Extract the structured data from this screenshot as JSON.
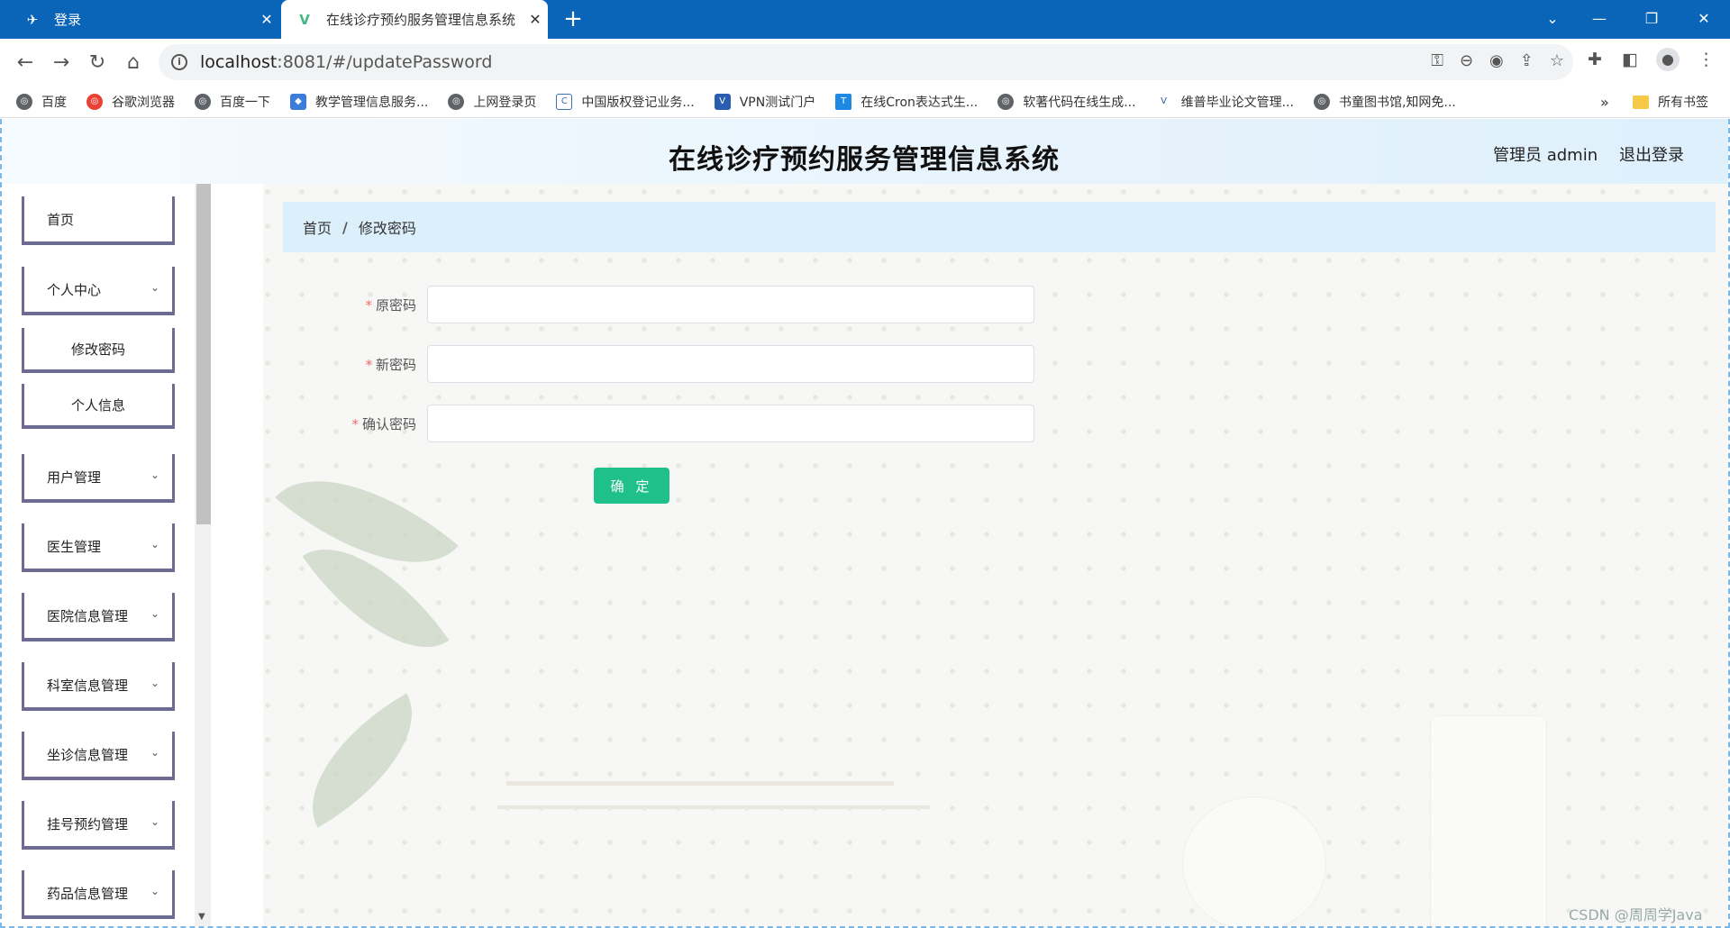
{
  "browser": {
    "tabs": [
      {
        "title": "登录",
        "icon": "page-icon"
      },
      {
        "title": "在线诊疗预约服务管理信息系统",
        "icon": "vue-icon"
      }
    ],
    "new_tab": "+",
    "url_host": "localhost",
    "url_rest": ":8081/#/updatePassword",
    "bookmarks": [
      {
        "label": "百度"
      },
      {
        "label": "谷歌浏览器"
      },
      {
        "label": "百度一下"
      },
      {
        "label": "教学管理信息服务..."
      },
      {
        "label": "上网登录页"
      },
      {
        "label": "中国版权登记业务..."
      },
      {
        "label": "VPN测试门户"
      },
      {
        "label": "在线Cron表达式生..."
      },
      {
        "label": "软著代码在线生成..."
      },
      {
        "label": "维普毕业论文管理..."
      },
      {
        "label": "书童图书馆,知网免..."
      }
    ],
    "bookmarks_more": "»",
    "all_bookmarks": "所有书签"
  },
  "header": {
    "title": "在线诊疗预约服务管理信息系统",
    "user": "管理员 admin",
    "logout": "退出登录"
  },
  "sidebar": {
    "items": [
      {
        "label": "首页"
      },
      {
        "label": "个人中心",
        "expand": "⌄"
      },
      {
        "label": "修改密码"
      },
      {
        "label": "个人信息"
      },
      {
        "label": "用户管理",
        "expand": "⌄"
      },
      {
        "label": "医生管理",
        "expand": "⌄"
      },
      {
        "label": "医院信息管理",
        "expand": "⌄"
      },
      {
        "label": "科室信息管理",
        "expand": "⌄"
      },
      {
        "label": "坐诊信息管理",
        "expand": "⌄"
      },
      {
        "label": "挂号预约管理",
        "expand": "⌄"
      },
      {
        "label": "药品信息管理",
        "expand": "⌄"
      }
    ]
  },
  "breadcrumb": {
    "home": "首页",
    "separator": "/",
    "current": "修改密码"
  },
  "form": {
    "fields": [
      {
        "label": "原密码",
        "required": "*",
        "value": ""
      },
      {
        "label": "新密码",
        "required": "*",
        "value": ""
      },
      {
        "label": "确认密码",
        "required": "*",
        "value": ""
      }
    ],
    "submit": "确 定"
  },
  "watermark": "CSDN @周周学Java",
  "colors": {
    "tab_bar": "#0a64b8",
    "submit_button": "#20c08a",
    "breadcrumb_bg": "#dcf0fc",
    "sidebar_border": "#6d6b8f",
    "required_mark": "#f56c6c"
  }
}
